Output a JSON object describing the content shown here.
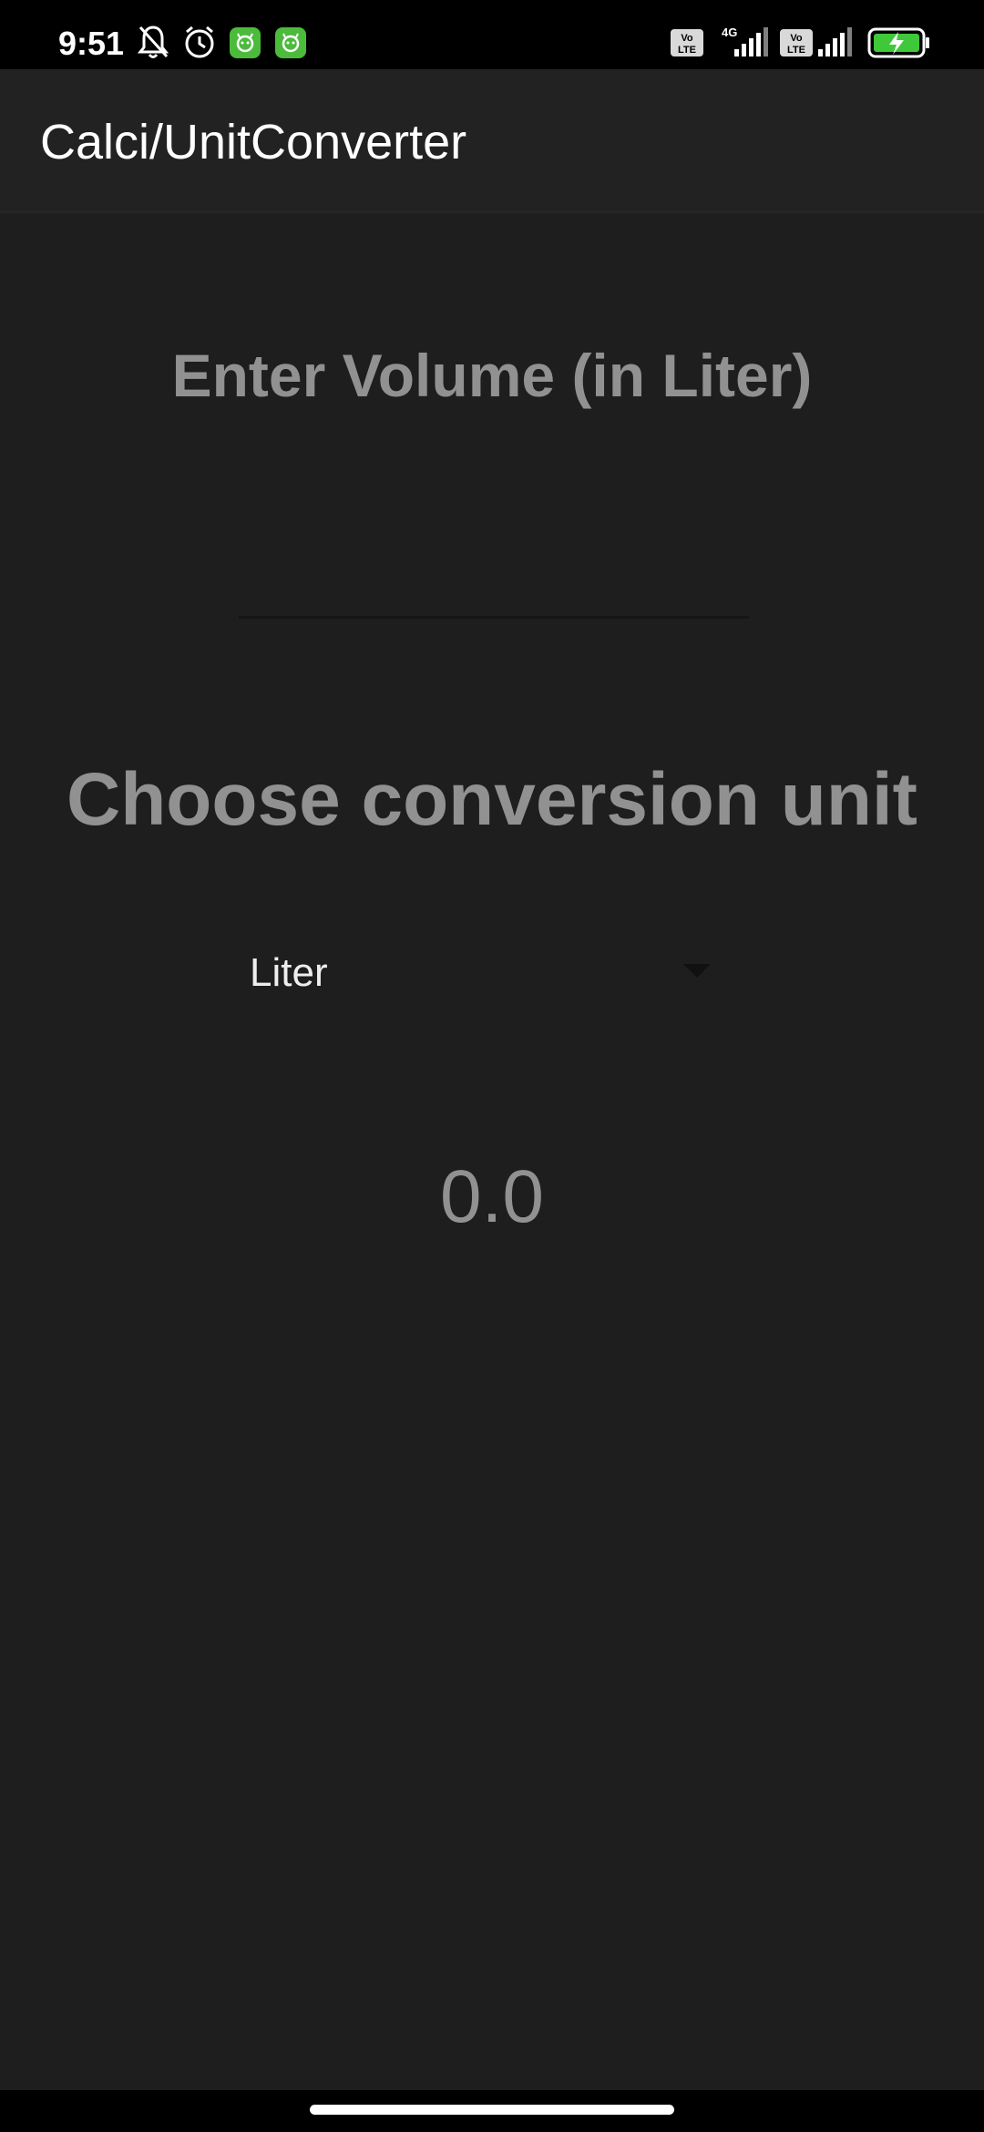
{
  "status_bar": {
    "time": "9:51",
    "icons_left": [
      "muted-bell-icon",
      "alarm-icon",
      "app-notification-icon",
      "app-notification-icon"
    ],
    "icons_right": [
      "volte-icon",
      "signal-4g-icon",
      "volte-icon",
      "signal-icon",
      "battery-charging-icon"
    ],
    "sim1_tech": "4G",
    "volte_label": "Vo LTE",
    "notification_color": "#4cbb3c",
    "battery_color": "#3ec83a"
  },
  "app_bar": {
    "title": "Calci/UnitConverter"
  },
  "main": {
    "volume_label": "Enter Volume (in Liter)",
    "volume_input_value": "",
    "unit_label": "Choose conversion unit",
    "unit_selected": "Liter",
    "result": "0.0"
  },
  "colors": {
    "background": "#1e1e1e",
    "app_bar": "#222222",
    "label_text": "#919191"
  }
}
